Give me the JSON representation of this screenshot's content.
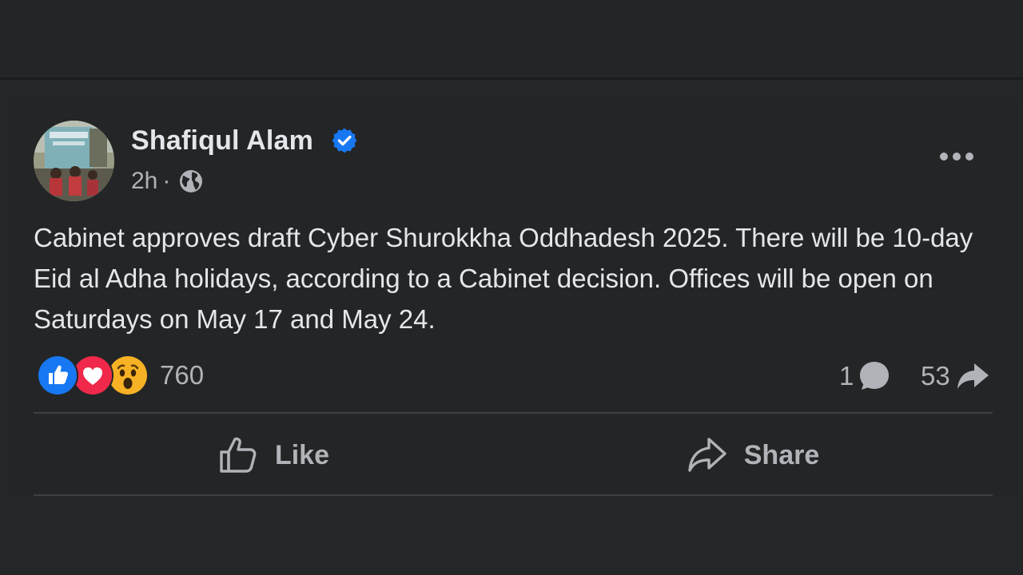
{
  "post": {
    "author": {
      "name": "Shafiqul Alam",
      "verified_icon": "verified-badge-icon",
      "avatar": "profile-photo"
    },
    "time": "2h",
    "separator": "·",
    "audience_icon": "globe-icon",
    "text": "Cabinet approves draft Cyber Shurokkha Oddhadesh 2025. There will be 10-day Eid al Adha holidays, according to a Cabinet decision. Offices will be open on Saturdays on May 17 and May 24.",
    "reactions": {
      "types": [
        "like",
        "love",
        "wow"
      ],
      "count": "760"
    },
    "comments_count": "1",
    "shares_count": "53",
    "actions": {
      "like_label": "Like",
      "share_label": "Share"
    }
  },
  "colors": {
    "background": "#242526",
    "primary_text": "#e4e6eb",
    "secondary_text": "#b0b3b8",
    "verified_blue": "#1877f2",
    "like_blue": "#1877f2",
    "love_red": "#f0284a",
    "wow_yellow": "#f7b125"
  }
}
